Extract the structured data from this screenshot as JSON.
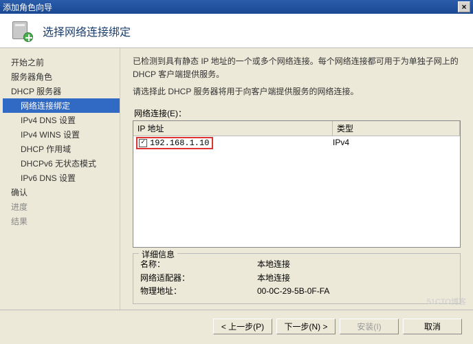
{
  "window": {
    "title": "添加角色向导"
  },
  "header": {
    "page_title": "选择网络连接绑定"
  },
  "sidebar": {
    "items": [
      {
        "label": "开始之前",
        "indent": false
      },
      {
        "label": "服务器角色",
        "indent": false
      },
      {
        "label": "DHCP 服务器",
        "indent": false
      },
      {
        "label": "网络连接绑定",
        "indent": true,
        "selected": true
      },
      {
        "label": "IPv4 DNS 设置",
        "indent": true
      },
      {
        "label": "IPv4 WINS 设置",
        "indent": true
      },
      {
        "label": "DHCP 作用域",
        "indent": true
      },
      {
        "label": "DHCPv6 无状态模式",
        "indent": true
      },
      {
        "label": "IPv6 DNS 设置",
        "indent": true
      },
      {
        "label": "确认",
        "indent": false
      },
      {
        "label": "进度",
        "indent": false,
        "disabled": true
      },
      {
        "label": "结果",
        "indent": false,
        "disabled": true
      }
    ]
  },
  "main": {
    "intro1": "已检测到具有静态 IP 地址的一个或多个网络连接。每个网络连接都可用于为单独子网上的 DHCP 客户端提供服务。",
    "intro2": "请选择此 DHCP 服务器将用于向客户端提供服务的网络连接。",
    "list_label": "网络连接(E)：",
    "columns": {
      "ip": "IP 地址",
      "type": "类型"
    },
    "rows": [
      {
        "checked": true,
        "ip": "192.168.1.10",
        "type": "IPv4"
      }
    ],
    "details": {
      "legend": "详细信息",
      "name_k": "名称：",
      "name_v": "本地连接",
      "adapter_k": "网络适配器：",
      "adapter_v": "本地连接",
      "mac_k": "物理地址：",
      "mac_v": "00-0C-29-5B-0F-FA"
    }
  },
  "footer": {
    "prev": "< 上一步(P)",
    "next": "下一步(N) >",
    "install": "安装(I)",
    "cancel": "取消"
  },
  "watermark": "51CTO博客"
}
